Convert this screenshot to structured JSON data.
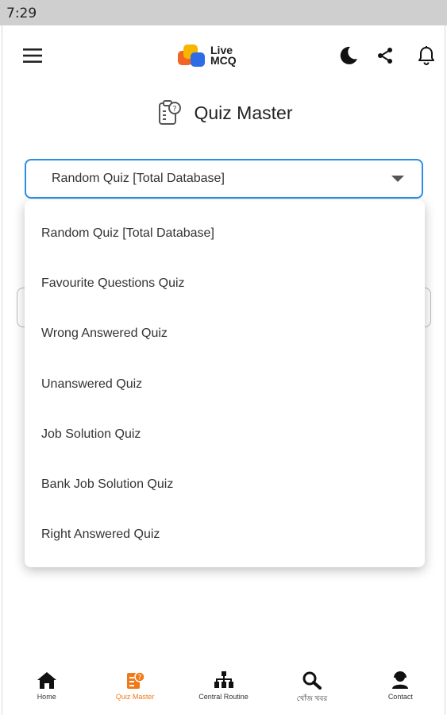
{
  "status_bar": {
    "time": "7:29"
  },
  "header": {
    "logo_line1": "Live",
    "logo_line2": "MCQ",
    "icons": [
      "hamburger-menu-icon",
      "dark-mode-moon-icon",
      "share-icon",
      "notification-bell-icon"
    ]
  },
  "page": {
    "title": "Quiz Master"
  },
  "quiz_select": {
    "selected": "Random Quiz [Total Database]",
    "options": [
      "Random Quiz [Total Database]",
      "Favourite Questions Quiz",
      "Wrong Answered Quiz",
      "Unanswered Quiz",
      "Job Solution Quiz",
      "Bank Job Solution Quiz",
      "Right Answered Quiz"
    ]
  },
  "bottom_nav": {
    "items": [
      {
        "label": "Home",
        "icon": "home-icon"
      },
      {
        "label": "Quiz Master",
        "icon": "quiz-icon"
      },
      {
        "label": "Central Routine",
        "icon": "routine-icon"
      },
      {
        "label": "খোঁজ খবর",
        "icon": "search-icon"
      },
      {
        "label": "Contact",
        "icon": "contact-icon"
      }
    ],
    "active_index": 1
  },
  "colors": {
    "accent": "#2b8ee6",
    "active_nav": "#f07a1a",
    "logo_yellow": "#f7b500",
    "logo_orange": "#f26522",
    "logo_blue": "#2e6be6"
  }
}
